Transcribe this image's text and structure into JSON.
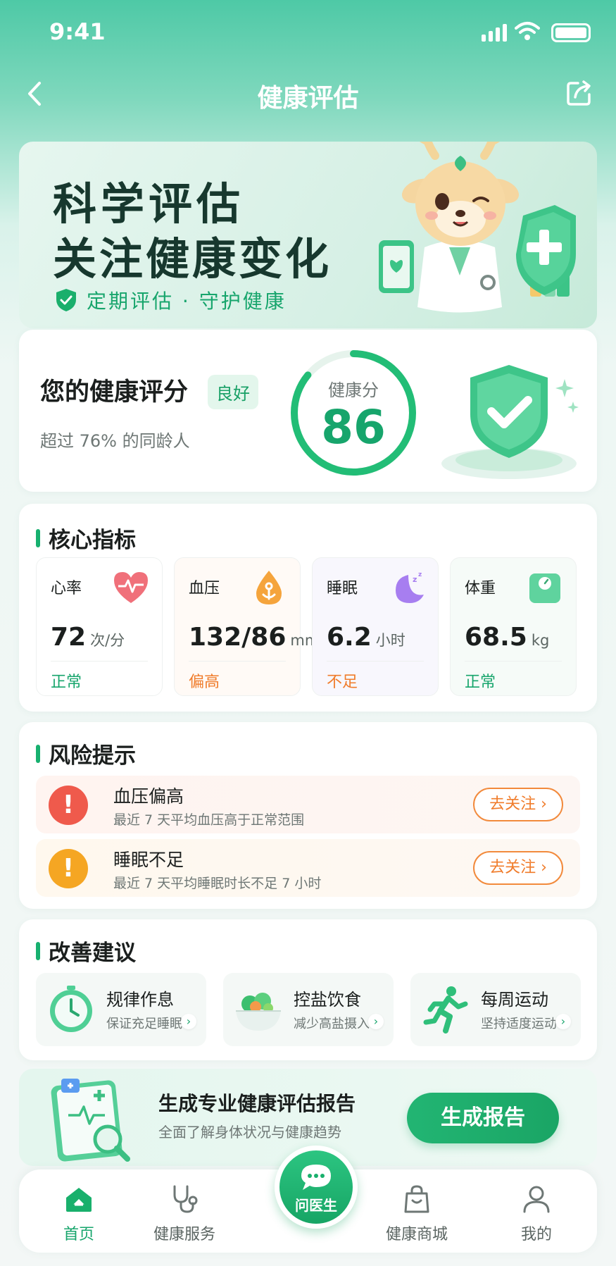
{
  "status_bar": {
    "time": "9:41"
  },
  "nav": {
    "title": "健康评估"
  },
  "banner": {
    "headline_1": "科学评估",
    "headline_2": "关注健康变化",
    "tagline": "定期评估 · 守护健康"
  },
  "score": {
    "label": "您的健康评分",
    "badge": "良好",
    "subtext": "超过 76% 的同龄人",
    "ring_label": "健康分",
    "value": "86",
    "progress_fraction": 0.86
  },
  "metrics": {
    "title": "核心指标",
    "items": [
      {
        "name": "心率",
        "value": "72",
        "unit": "次/分",
        "status": "正常",
        "status_color": "#17a56c",
        "bg": "#ffffff"
      },
      {
        "name": "血压",
        "value": "132/86",
        "unit": "mmHg",
        "status": "偏高",
        "status_color": "#f07c2b",
        "bg": "#fffaf6"
      },
      {
        "name": "睡眠",
        "value": "6.2",
        "unit": "小时",
        "status": "不足",
        "status_color": "#f07c2b",
        "bg": "#f8f7fd"
      },
      {
        "name": "体重",
        "value": "68.5",
        "unit": "kg",
        "status": "正常",
        "status_color": "#17a56c",
        "bg": "#f6fbf8"
      }
    ]
  },
  "risks": {
    "title": "风险提示",
    "items": [
      {
        "title": "血压偏高",
        "desc": "最近 7 天平均血压高于正常范围",
        "action": "去关注 ›",
        "icon_color": "#ef5a4c"
      },
      {
        "title": "睡眠不足",
        "desc": "最近 7 天平均睡眠时长不足 7 小时",
        "action": "去关注 ›",
        "icon_color": "#f5a623"
      }
    ]
  },
  "advice": {
    "title": "改善建议",
    "items": [
      {
        "title": "规律作息",
        "desc": "保证充足睡眠"
      },
      {
        "title": "控盐饮食",
        "desc": "减少高盐摄入"
      },
      {
        "title": "每周运动",
        "desc": "坚持适度运动"
      }
    ]
  },
  "report": {
    "title": "生成专业健康评估报告",
    "desc": "全面了解身体状况与健康趋势",
    "button": "生成报告"
  },
  "tabbar": {
    "items": [
      "首页",
      "健康服务",
      "问医生",
      "健康商城",
      "我的"
    ],
    "active": "首页"
  },
  "colors": {
    "brand": "#17a56c",
    "warning": "#f07c2b"
  }
}
